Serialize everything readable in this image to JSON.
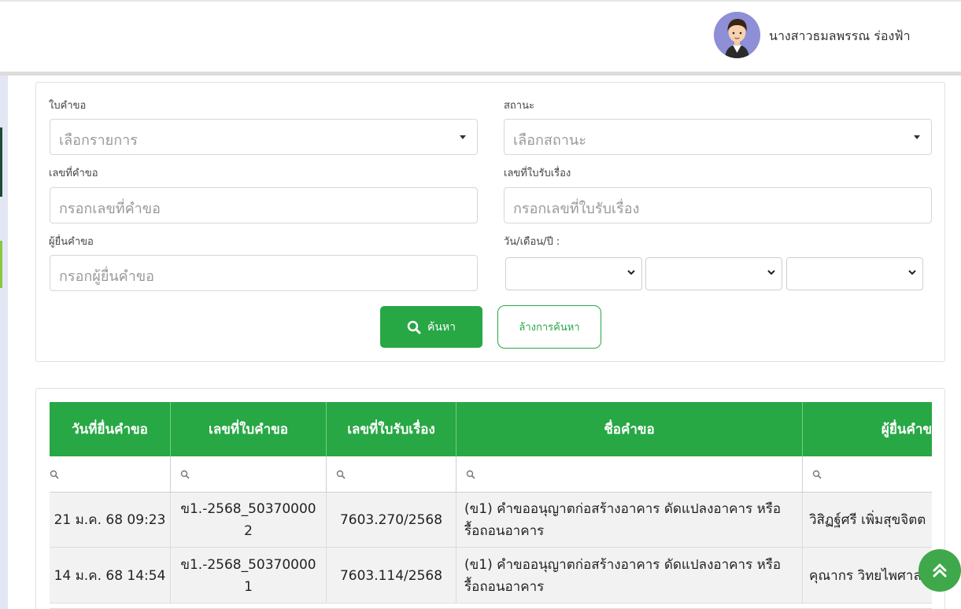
{
  "header": {
    "user_name": "นางสาวธมลพรรณ ร่องฟ้า"
  },
  "filters": {
    "request_type": {
      "label": "ใบคำขอ",
      "placeholder": "เลือกรายการ"
    },
    "status": {
      "label": "สถานะ",
      "placeholder": "เลือกสถานะ"
    },
    "request_no": {
      "label": "เลขที่คำขอ",
      "placeholder": "กรอกเลขที่คำขอ"
    },
    "receipt_no": {
      "label": "เลขที่ใบรับเรื่อง",
      "placeholder": "กรอกเลขที่ใบรับเรื่อง"
    },
    "applicant": {
      "label": "ผู้ยื่นคำขอ",
      "placeholder": "กรอกผู้ยื่นคำขอ"
    },
    "date": {
      "label": "วัน/เดือน/ปี :"
    }
  },
  "buttons": {
    "search_label": "ค้นหา",
    "clear_label": "ล้างการค้นหา"
  },
  "table": {
    "columns": [
      "วันที่ยื่นคำขอ",
      "เลขที่ใบคำขอ",
      "เลขที่ใบรับเรื่อง",
      "ชื่อคำขอ",
      "ผู้ยื่นคำข"
    ],
    "rows": [
      {
        "date": "21 ม.ค. 68 09:23",
        "request_no": "ข1.-2568_503700002",
        "receipt_no": "7603.270/2568",
        "name": "(ข1) คำขออนุญาตก่อสร้างอาคาร ดัดแปลงอาคาร หรือรื้อถอนอาคาร",
        "applicant": "วิสิฏฐ์ศรี เพิ่มสุขจิตต"
      },
      {
        "date": "14 ม.ค. 68 14:54",
        "request_no": "ข1.-2568_503700001",
        "receipt_no": "7603.114/2568",
        "name": "(ข1) คำขออนุญาตก่อสร้างอาคาร ดัดแปลงอาคาร หรือรื้อถอนอาคาร",
        "applicant": "คุณากร วิทยไพศาล"
      }
    ]
  },
  "colors": {
    "primary": "#28a745",
    "row_bg": "#f2f2f2",
    "avatar_bg": "#8e8fd6"
  },
  "icons": {
    "search": "search-icon",
    "scroll_top": "double-chevron-up-icon"
  }
}
